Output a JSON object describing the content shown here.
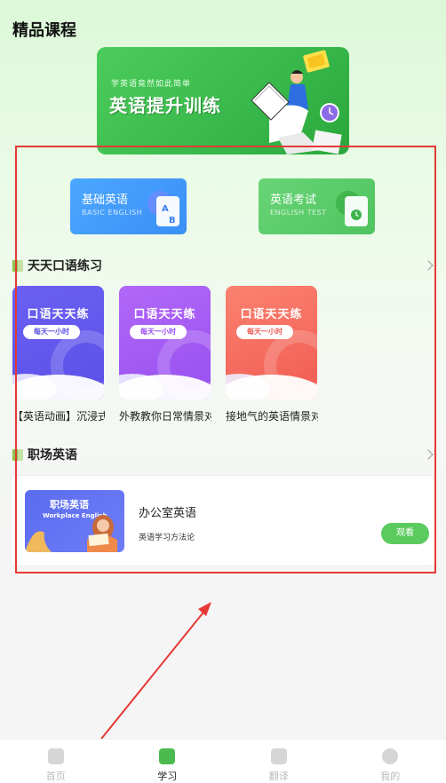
{
  "header": {
    "title": "精品课程"
  },
  "banner": {
    "subtitle": "学英语竟然如此简单",
    "title": "英语提升训练"
  },
  "categories": [
    {
      "cn": "基础英语",
      "en": "BASIC ENGLISH",
      "icon": "ab-letter-icon",
      "color": "#3b8ff5"
    },
    {
      "cn": "英语考试",
      "en": "ENGLISH TEST",
      "icon": "document-clock-icon",
      "color": "#4fc45f"
    }
  ],
  "oral_section": {
    "title": "天天口语练习",
    "cards": [
      {
        "cover_title": "口语天天练",
        "pill": "每天一小时",
        "title": "【英语动画】沉浸式",
        "color": "#6d5bf0"
      },
      {
        "cover_title": "口语天天练",
        "pill": "每天一小时",
        "title": "外教教你日常情景对",
        "color": "#a05cf5"
      },
      {
        "cover_title": "口语天天练",
        "pill": "每天一小时",
        "title": "接地气的英语情景对",
        "color": "#f36f62"
      }
    ]
  },
  "work_section": {
    "title": "职场英语",
    "card": {
      "thumb_title": "职场英语",
      "thumb_sub": "Workplace English",
      "title": "办公室英语",
      "subtitle": "英语学习方法论",
      "button": "观看"
    }
  },
  "bottom_nav": [
    {
      "label": "首页",
      "icon": "home-icon",
      "active": false
    },
    {
      "label": "学习",
      "icon": "book-icon",
      "active": true
    },
    {
      "label": "翻译",
      "icon": "translate-icon",
      "active": false
    },
    {
      "label": "我的",
      "icon": "profile-icon",
      "active": false
    }
  ],
  "colors": {
    "accent": "#4cbb4f",
    "annotation": "#e53935"
  }
}
